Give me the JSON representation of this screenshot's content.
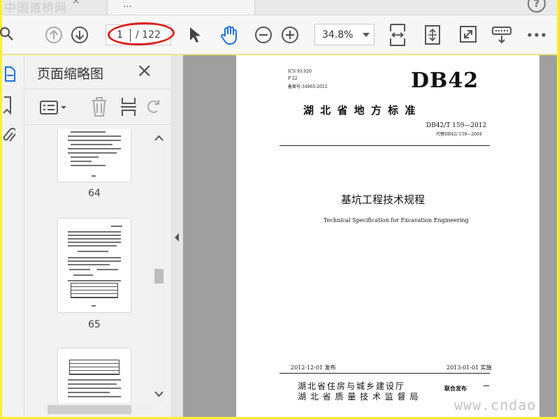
{
  "tab": {
    "title": "...",
    "watermark": "中国道桥网"
  },
  "toolbar": {
    "page_current": "1",
    "page_total": "/ 122",
    "zoom": "34.8%"
  },
  "sidebar": {
    "title": "页面缩略图",
    "thumbnails": [
      {
        "label": "64"
      },
      {
        "label": "65"
      }
    ]
  },
  "document": {
    "ics": "ICS 93.020",
    "pcode": "P 22",
    "record": "备案号:34965-2012",
    "badge": "DB42",
    "authority": "湖 北 省 地 方 标 准",
    "std_no": "DB42/T 159—2012",
    "replaces": "代替DB42/ 159—2004",
    "title_cn": "基坑工程技术规程",
    "title_en": "Technical Specification for Excavation Engineering",
    "publish_date": "2012-12-01 发布",
    "effective_date": "2013-01-01 实施",
    "issuer1": "湖北省住房与城乡建设厅",
    "issuer2": "湖 北 省 质 量 技 术 监 督 局",
    "joint": "联合发布"
  },
  "watermark_bottom": "www.cndao",
  "colors": {
    "highlight_oval": "#d9211f",
    "frame": "#f9ee3a"
  }
}
